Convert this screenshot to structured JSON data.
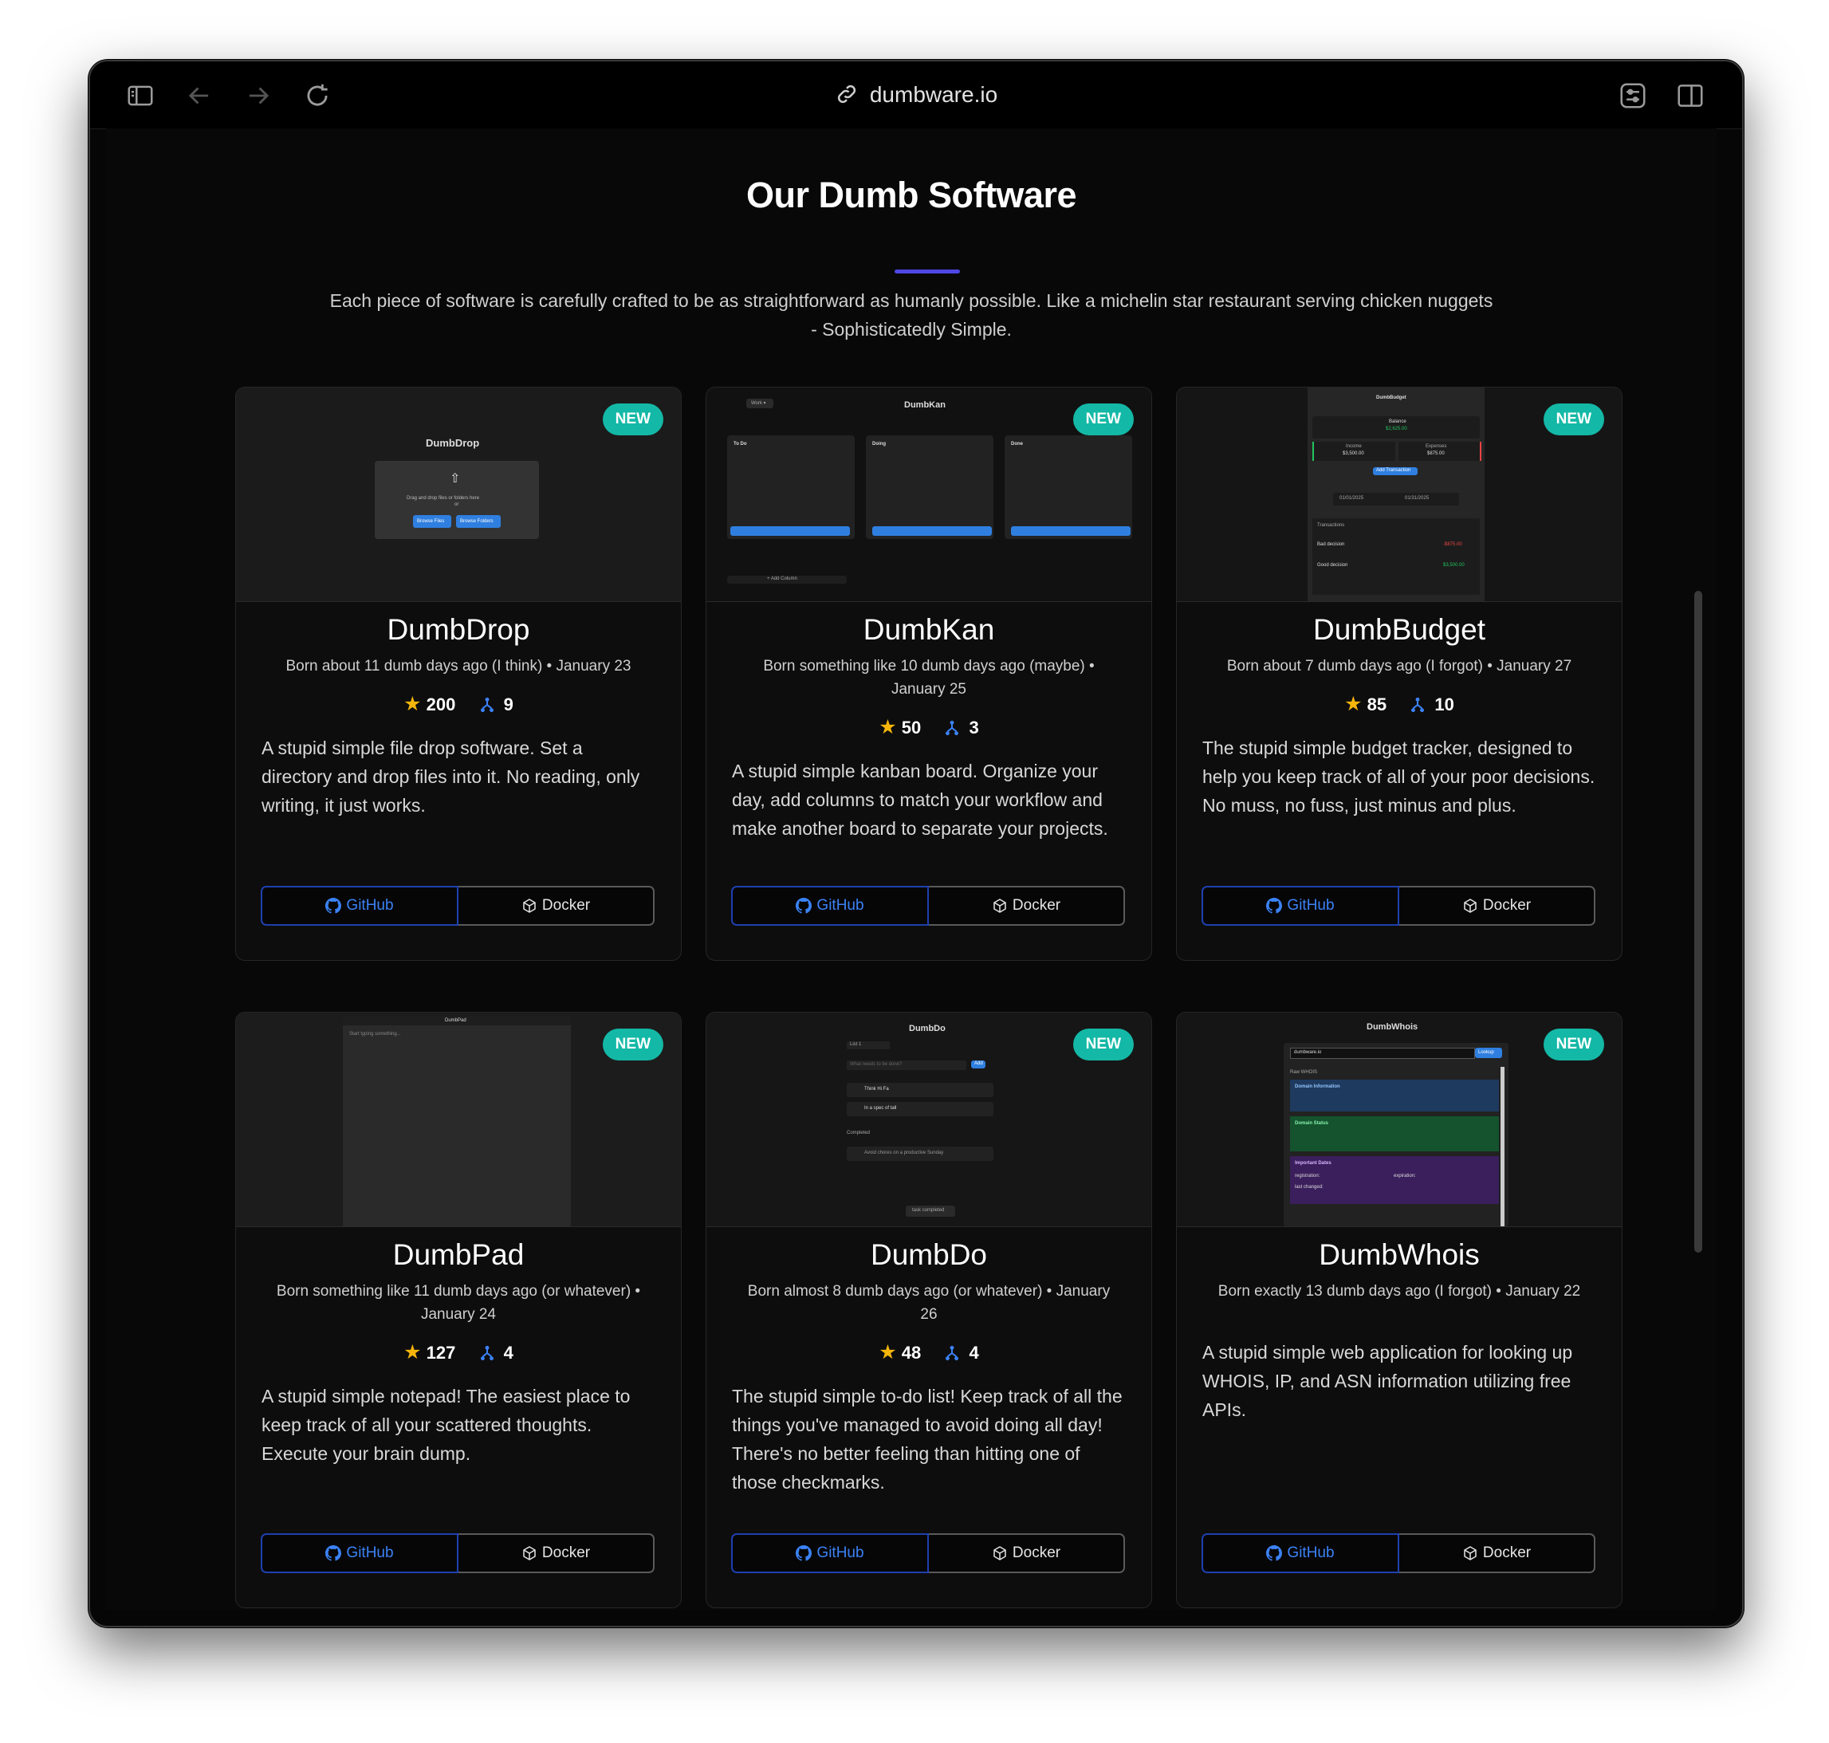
{
  "browser": {
    "url": "dumbware.io"
  },
  "page": {
    "title": "Our Dumb Software",
    "subtitle": "Each piece of software is carefully crafted to be as straightforward as humanly possible. Like a michelin star restaurant serving chicken nuggets - Sophisticatedly Simple."
  },
  "colors": {
    "badge": "#14b8a6",
    "accent": "#4f46e5",
    "github": "#3b82f6",
    "star": "#f5b50a"
  },
  "cards": [
    {
      "name": "DumbDrop",
      "badge": "NEW",
      "born": "Born about 11 dumb days ago (I think) • January 23",
      "stars": "200",
      "forks": "9",
      "description": "A stupid simple file drop software. Set a directory and drop files into it. No reading, only writing, it just works.",
      "github_label": "GitHub",
      "docker_label": "Docker",
      "preview": {
        "title": "DumbDrop",
        "drop_text": "Drag and drop files or folders here",
        "or_text": "or",
        "browse_files": "Browse Files",
        "browse_folders": "Browse Folders"
      }
    },
    {
      "name": "DumbKan",
      "badge": "NEW",
      "born": "Born something like 10 dumb days ago (maybe) • January 25",
      "stars": "50",
      "forks": "3",
      "description": "A stupid simple kanban board. Organize your day, add columns to match your workflow and make another board to separate your projects.",
      "github_label": "GitHub",
      "docker_label": "Docker",
      "preview": {
        "title": "DumbKan",
        "board_select": "Work ▾",
        "columns": [
          "To Do",
          "Doing",
          "Done"
        ],
        "add_task": "+ Add Task",
        "add_column": "+ Add Column"
      }
    },
    {
      "name": "DumbBudget",
      "badge": "NEW",
      "born": "Born about 7 dumb days ago (I forgot) • January 27",
      "stars": "85",
      "forks": "10",
      "description": "The stupid simple budget tracker, designed to help you keep track of all of your poor decisions. No muss, no fuss, just minus and plus.",
      "github_label": "GitHub",
      "docker_label": "Docker",
      "preview": {
        "title": "DumbBudget",
        "balance_label": "Balance",
        "balance": "$2,625.00",
        "income_label": "Income",
        "income": "$3,500.00",
        "expenses_label": "Expenses",
        "expenses": "$875.00",
        "add_button": "Add Transaction",
        "date_from": "01/01/2025",
        "date_to": "01/31/2025",
        "transactions_label": "Transactions",
        "tx1_name": "Bad decision",
        "tx1_amount": "-$875.00",
        "tx2_name": "Good decision",
        "tx2_amount": "$3,500.00"
      }
    },
    {
      "name": "DumbPad",
      "badge": "NEW",
      "born": "Born something like 11 dumb days ago (or whatever) • January 24",
      "stars": "127",
      "forks": "4",
      "description": "A stupid simple notepad! The easiest place to keep track of all your scattered thoughts. Execute your brain dump.",
      "github_label": "GitHub",
      "docker_label": "Docker",
      "preview": {
        "title": "DumbPad",
        "body": "Start typing something..."
      }
    },
    {
      "name": "DumbDo",
      "badge": "NEW",
      "born": "Born almost 8 dumb days ago (or whatever) • January 26",
      "stars": "48",
      "forks": "4",
      "description": "The stupid simple to-do list! Keep track of all the things you've managed to avoid doing all day! There's no better feeling than hitting one of those checkmarks.",
      "github_label": "GitHub",
      "docker_label": "Docker",
      "preview": {
        "title": "DumbDo",
        "list_select": "List 1",
        "input_placeholder": "What needs to be done?",
        "add": "Add",
        "task1": "Think Hi Fa",
        "task2": "In a spec of tall",
        "completed_label": "Completed",
        "task3": "Avoid chores on a productive Sunday",
        "footer": "task completed"
      }
    },
    {
      "name": "DumbWhois",
      "badge": "NEW",
      "born": "Born exactly 13 dumb days ago (I forgot) • January 22",
      "stars": "",
      "forks": "",
      "description": "A stupid simple web application for looking up WHOIS, IP, and ASN information utilizing free APIs.",
      "github_label": "GitHub",
      "docker_label": "Docker",
      "preview": {
        "title": "DumbWhois",
        "input_value": "dumbware.io",
        "lookup": "Lookup",
        "raw_label": "Raw WHOIS",
        "domain_info": "Domain Information",
        "domain_status": "Domain Status",
        "important_dates": "Important Dates",
        "registration": "registration:",
        "expiration": "expiration:",
        "last_changed": "last changed:"
      }
    }
  ]
}
